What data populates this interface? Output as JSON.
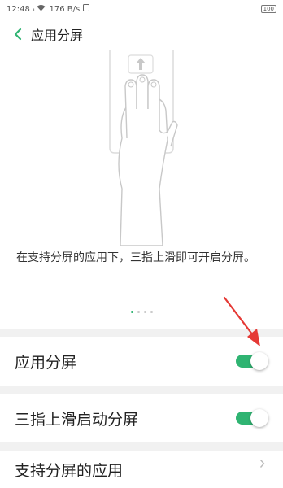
{
  "status_bar": {
    "time": "12:48",
    "signal": "⁴ᴳ",
    "net_speed": "176 B/s",
    "battery": "100"
  },
  "header": {
    "title": "应用分屏"
  },
  "intro": {
    "description": "在支持分屏的应用下，三指上滑即可开启分屏。",
    "page_count": 4,
    "active_page": 1
  },
  "settings": {
    "app_split": {
      "label": "应用分屏",
      "enabled": true
    },
    "three_finger": {
      "label": "三指上滑启动分屏",
      "enabled": true
    },
    "supported_apps": {
      "label": "支持分屏的应用"
    }
  },
  "colors": {
    "accent": "#2fb472",
    "annotation_arrow": "#e53935"
  }
}
